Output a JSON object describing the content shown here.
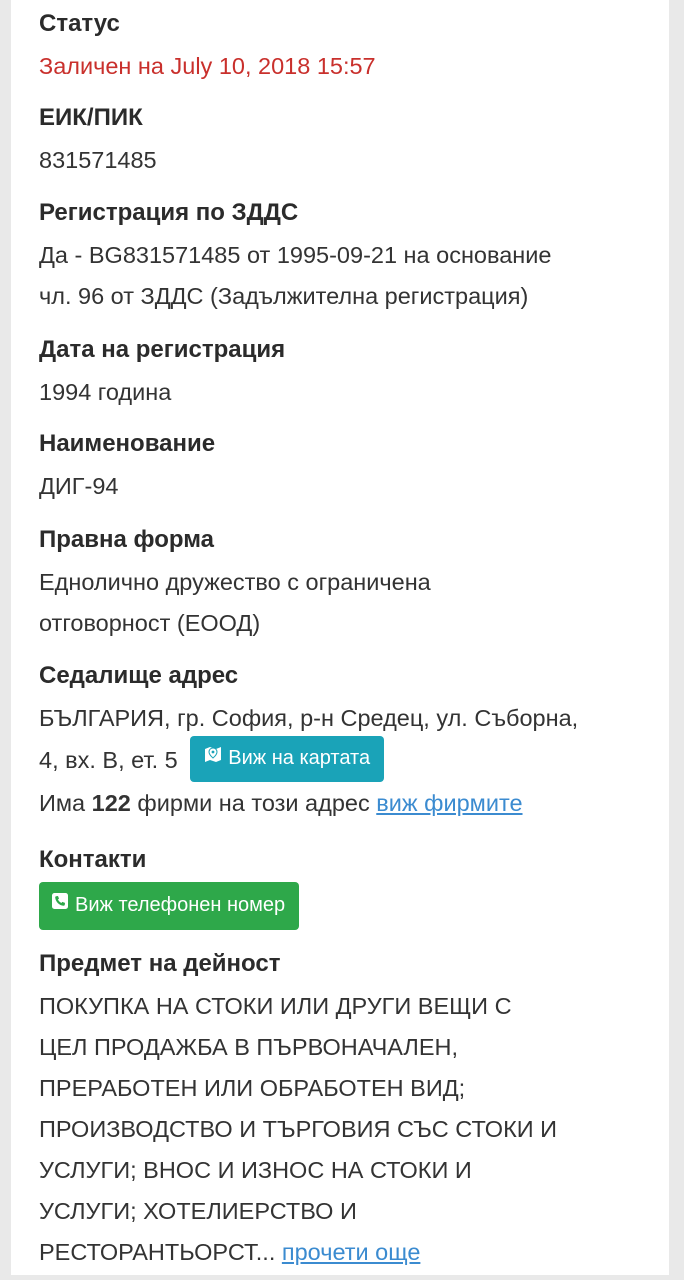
{
  "status": {
    "label": "Статус",
    "value": "Заличен на July 10, 2018 15:57"
  },
  "eik": {
    "label": "ЕИК/ПИК",
    "value": "831571485"
  },
  "vat": {
    "label": "Регистрация по ЗДДС",
    "line1": "Да - BG831571485 от 1995-09-21 на основание",
    "line2": "чл. 96 от ЗДДС (Задължителна регистрация)"
  },
  "reg_date": {
    "label": "Дата на регистрация",
    "value": "1994 година"
  },
  "name": {
    "label": "Наименование",
    "value": "ДИГ-94"
  },
  "legal_form": {
    "label": "Правна форма",
    "line1": "Еднолично дружество с ограничена",
    "line2": "отговорност (ЕООД)"
  },
  "address": {
    "label": "Седалище адрес",
    "line1": "БЪЛГАРИЯ, гр. София, р-н Средец, ул. Съборна,",
    "line2": "4, вх. В, ет. 5",
    "map_button": "Виж на картата",
    "companies_prefix": "Има",
    "companies_count": "122",
    "companies_suffix": "фирми на този адрес",
    "companies_link": "виж фирмите"
  },
  "contacts": {
    "label": "Контакти",
    "phone_button": "Виж телефонен номер"
  },
  "activity": {
    "label": "Предмет на дейност",
    "lines": [
      "ПОКУПКА НА СТОКИ ИЛИ ДРУГИ ВЕЩИ С",
      "ЦЕЛ ПРОДАЖБА В ПЪРВОНАЧАЛЕН,",
      "ПРЕРАБОТЕН ИЛИ ОБРАБОТЕН ВИД;",
      "ПРОИЗВОДСТВО И ТЪРГОВИЯ СЪС СТОКИ И",
      "УСЛУГИ; ВНОС И ИЗНОС НА СТОКИ И",
      "УСЛУГИ; ХОТЕЛИЕРСТВО И"
    ],
    "last_line": "РЕСТОРАНТЬОРСТ...",
    "read_more": "прочети още"
  },
  "colors": {
    "status_red": "#c9302c",
    "map_button": "#1aa3b8",
    "phone_button": "#2ea84a",
    "link": "#3b8bd0"
  }
}
